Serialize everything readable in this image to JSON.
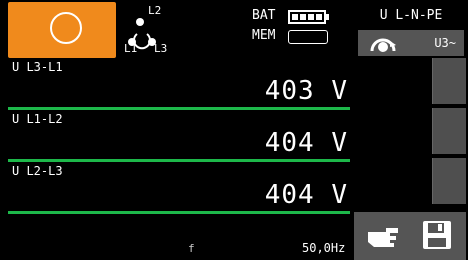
{
  "header": {
    "phase_labels": [
      "L2",
      "L1",
      "L3"
    ],
    "battery_label": "BAT",
    "memory_label": "MEM",
    "battery_level": 1.0,
    "mode_title": "U L-N-PE",
    "mode_sub_label": "U3~"
  },
  "measurements": [
    {
      "label": "U L3-L1",
      "value": "403 V"
    },
    {
      "label": "U L1-L2",
      "value": "404 V"
    },
    {
      "label": "U L2-L3",
      "value": "404 V"
    }
  ],
  "footer": {
    "freq_label": "f",
    "freq_value": "50,0Hz"
  },
  "colors": {
    "accent": "#f08a1c",
    "line": "#1db84a",
    "panel": "#555555"
  },
  "icons": [
    "phase-diagram-icon",
    "battery-icon",
    "memory-icon",
    "rotary-switch-icon",
    "hand-pointer-icon",
    "save-icon"
  ]
}
